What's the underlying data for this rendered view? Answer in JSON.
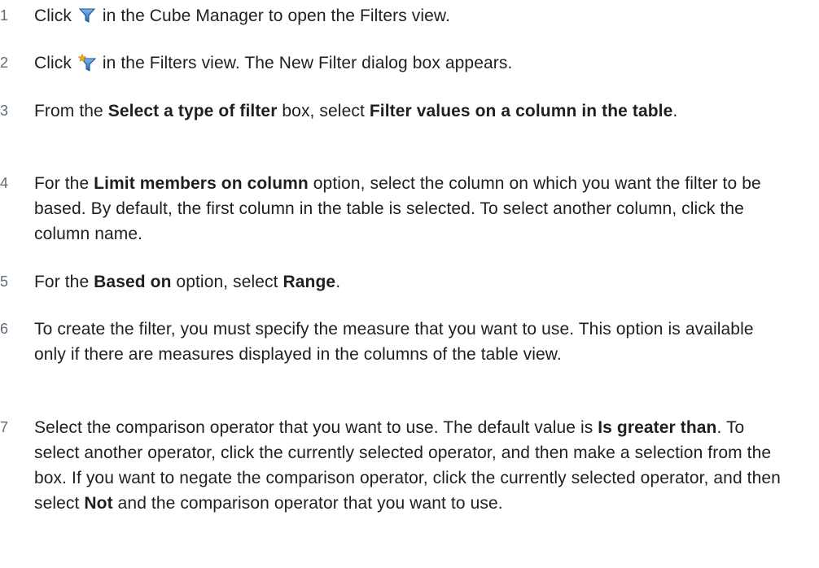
{
  "steps": [
    {
      "number": "1",
      "before_icon": "Click ",
      "icon": "filter-icon",
      "after_icon": " in the Cube Manager to open the Filters view."
    },
    {
      "number": "2",
      "before_icon": "Click ",
      "icon": "new-filter-icon",
      "after_icon": " in the Filters view. The New Filter dialog box appears."
    },
    {
      "number": "3",
      "t1": "From the ",
      "b1": "Select a type of filter",
      "t2": " box, select ",
      "b2": "Filter values on a column in the table",
      "t3": "."
    },
    {
      "number": "4",
      "t1": "For the ",
      "b1": "Limit members on column",
      "t2": " option, select the column on which you want the filter to be based. By default, the first column in the table is selected. To select another column, click the column name."
    },
    {
      "number": "5",
      "t1": "For the ",
      "b1": "Based on",
      "t2": " option, select ",
      "b2": "Range",
      "t3": "."
    },
    {
      "number": "6",
      "t1": "To create the filter, you must specify the measure that you want to use. This option is available only if there are measures displayed in the columns of the table view."
    },
    {
      "number": "7",
      "t1": "Select the comparison operator that you want to use. The default value is ",
      "b1": "Is greater than",
      "t2": ". To select another operator, click the currently selected operator, and then make a selection from the box. If you want to negate the comparison operator, click the currently selected operator, and then select ",
      "b2": "Not",
      "t3": " and the comparison operator that you want to use."
    }
  ],
  "colors": {
    "text": "#1f1f1f",
    "step_number": "#5f6b78",
    "filter_icon_blue": "#2f7fd0",
    "new_filter_star": "#f2a81d"
  }
}
